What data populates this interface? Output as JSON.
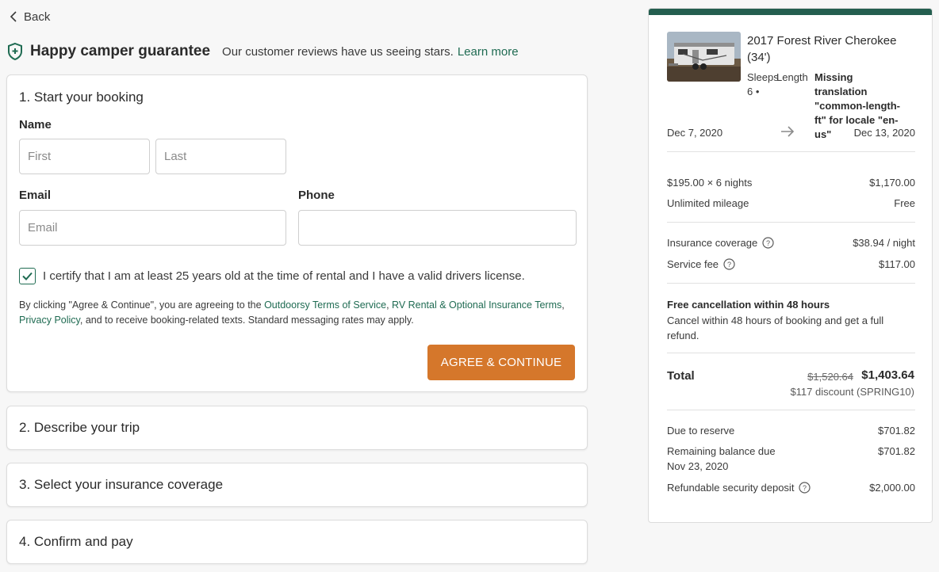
{
  "nav": {
    "back_label": "Back"
  },
  "guarantee": {
    "title": "Happy camper guarantee",
    "description": "Our customer reviews have us seeing stars.",
    "link": "Learn more"
  },
  "booking": {
    "step1_title": "1. Start your booking",
    "name_label": "Name",
    "first_placeholder": "First",
    "last_placeholder": "Last",
    "first_value": "",
    "last_value": "",
    "email_label": "Email",
    "email_placeholder": "Email",
    "email_value": "",
    "phone_label": "Phone",
    "phone_placeholder": "",
    "phone_value": "",
    "certify_checked": true,
    "certify_text": "I certify that I am at least 25 years old at the time of rental and I have a valid drivers license.",
    "legal_prefix": "By clicking \"Agree & Continue\", you are agreeing to the ",
    "legal_link1": "Outdoorsy Terms of Service",
    "legal_sep1": ", ",
    "legal_link2": "RV Rental & Optional Insurance Terms",
    "legal_sep2": ", ",
    "legal_link3": "Privacy Policy",
    "legal_suffix": ", and to receive booking-related texts. Standard messaging rates may apply.",
    "agree_button": "AGREE & CONTINUE"
  },
  "steps": {
    "step2": "2. Describe your trip",
    "step3": "3. Select your insurance coverage",
    "step4": "4. Confirm and pay"
  },
  "summary": {
    "rv_title": "2017 Forest River Cherokee (34')",
    "sleeps_label": "Sleeps",
    "sleeps_value": "6",
    "bullet": "•",
    "length_label": "Length",
    "length_value": "Missing translation \"common-length-ft\" for locale \"en-us\"",
    "start_date": "Dec 7, 2020",
    "end_date": "Dec 13, 2020",
    "nightly_label": "$195.00 × 6 nights",
    "nightly_value": "$1,170.00",
    "mileage_label": "Unlimited mileage",
    "mileage_value": "Free",
    "insurance_label": "Insurance coverage",
    "insurance_value": "$38.94 / night",
    "service_label": "Service fee",
    "service_value": "$117.00",
    "cancel_title": "Free cancellation within 48 hours",
    "cancel_desc": "Cancel within 48 hours of booking and get a full refund.",
    "total_label": "Total",
    "total_old": "$1,520.64",
    "total_new": "$1,403.64",
    "discount": "$117 discount (SPRING10)",
    "reserve_label": "Due to reserve",
    "reserve_value": "$701.82",
    "remaining_label": "Remaining balance due",
    "remaining_date": "Nov 23, 2020",
    "remaining_value": "$701.82",
    "deposit_label": "Refundable security deposit",
    "deposit_value": "$2,000.00"
  },
  "colors": {
    "brand_green": "#1f6b52",
    "accent_orange": "#d5772b",
    "topbar": "#245e4f"
  },
  "icons": [
    "chevron-left-icon",
    "shield-icon",
    "check-icon",
    "arrow-right-icon",
    "info-icon"
  ]
}
